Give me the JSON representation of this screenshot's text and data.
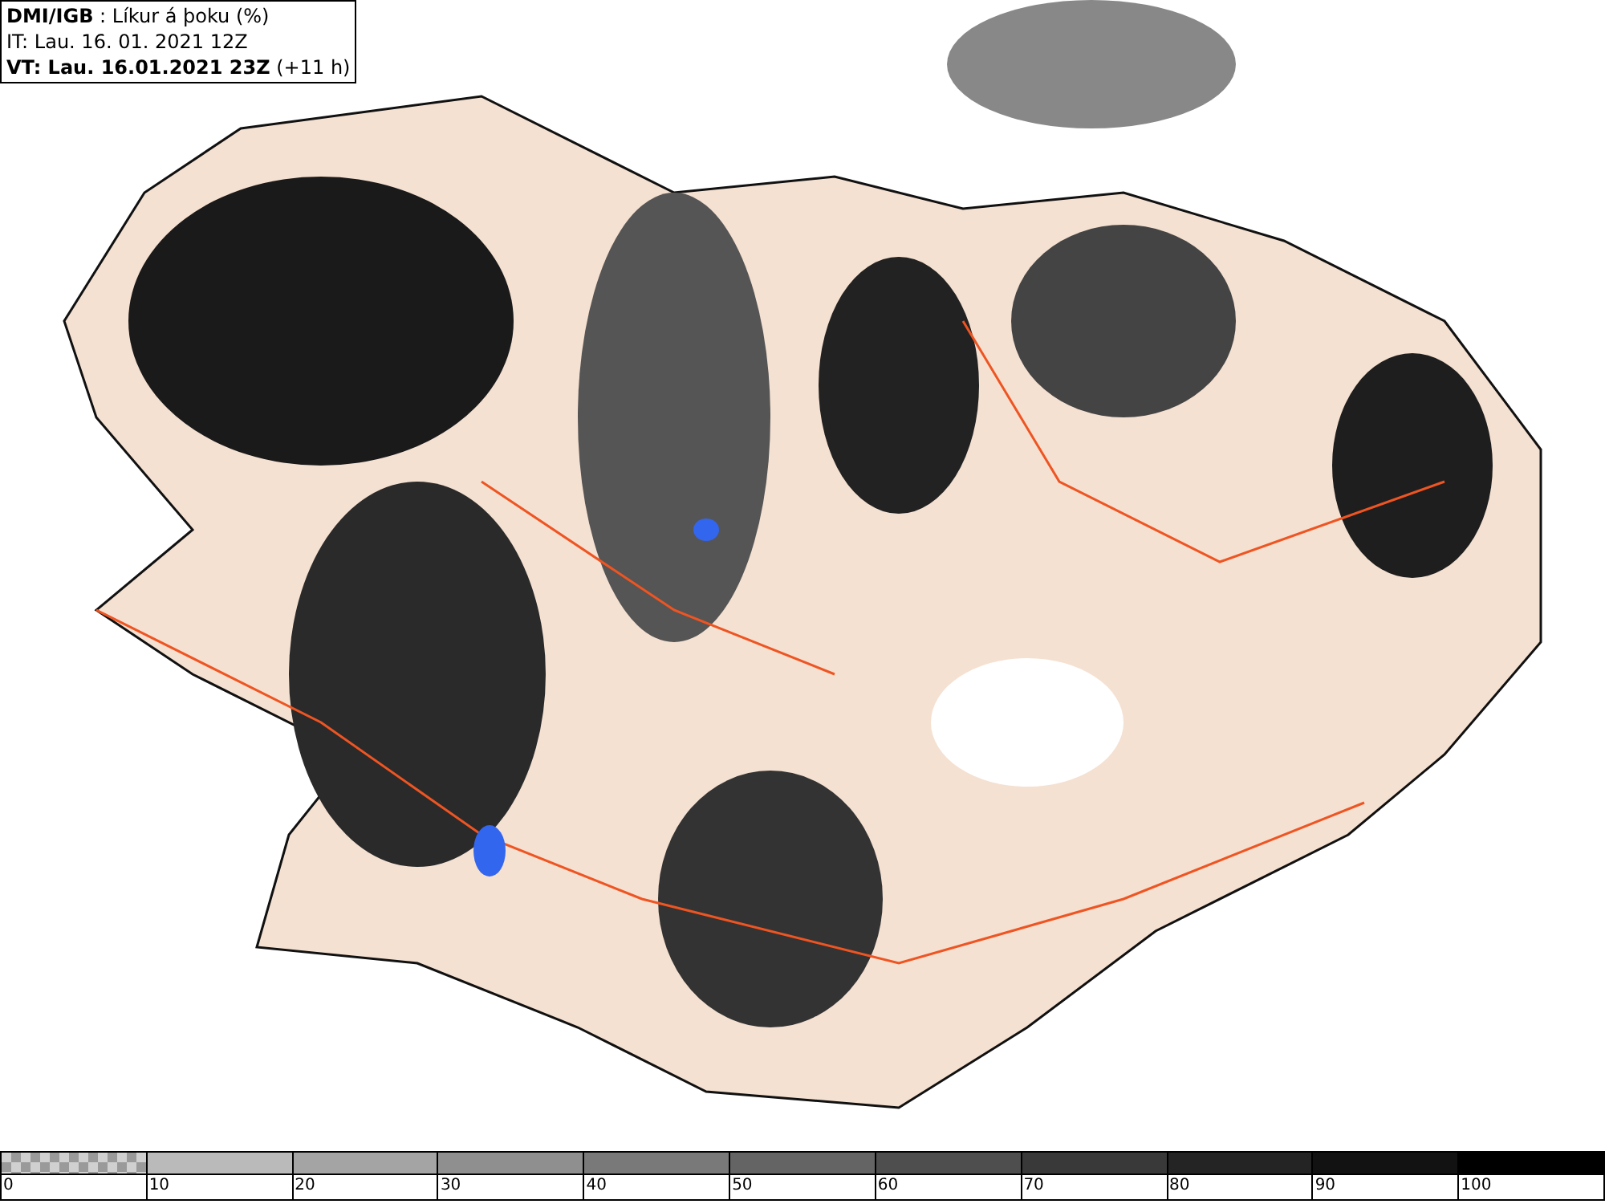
{
  "header": {
    "lines": [
      "**DMI/IGB** : Líkur á þoku (%)",
      "IT: Lau. 16. 01. 2021 12Z",
      "**VT: Lau. 16.01.2021 23Z** (+11 h)"
    ]
  },
  "legend": [
    {
      "label": "0",
      "kind": "checker",
      "color": "#9a9a9a"
    },
    {
      "label": "10",
      "kind": "solid",
      "color": "#bababa"
    },
    {
      "label": "20",
      "kind": "solid",
      "color": "#a4a4a4"
    },
    {
      "label": "30",
      "kind": "solid",
      "color": "#8f8f8f"
    },
    {
      "label": "40",
      "kind": "solid",
      "color": "#797979"
    },
    {
      "label": "50",
      "kind": "solid",
      "color": "#646464"
    },
    {
      "label": "60",
      "kind": "solid",
      "color": "#4e4e4e"
    },
    {
      "label": "70",
      "kind": "solid",
      "color": "#393939"
    },
    {
      "label": "80",
      "kind": "solid",
      "color": "#242424"
    },
    {
      "label": "90",
      "kind": "solid",
      "color": "#121212"
    },
    {
      "label": "100",
      "kind": "solid",
      "color": "#000000"
    }
  ]
}
